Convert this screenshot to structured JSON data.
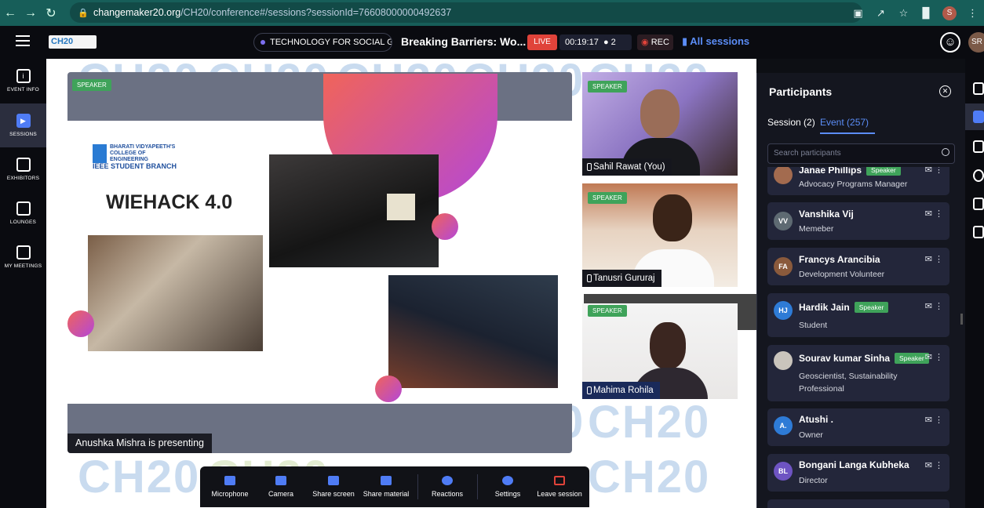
{
  "browser": {
    "url_domain": "changemaker20.org",
    "url_path": "/CH20/conference#/sessions?sessionId=76608000000492637",
    "profile_initial": "S"
  },
  "header": {
    "logo_text": "CH20",
    "track_label": "TECHNOLOGY FOR SOCIAL GO...",
    "session_title": "Breaking Barriers: Wo...",
    "live_label": "LIVE",
    "timer": "00:19:17",
    "attendee_count": "2",
    "rec_label": "REC",
    "all_sessions_label": "All sessions",
    "user_initials": "SR"
  },
  "left_nav": [
    {
      "label": "EVENT INFO",
      "icon": "info-icon",
      "active": false
    },
    {
      "label": "SESSIONS",
      "icon": "play-icon",
      "active": true
    },
    {
      "label": "EXHIBITORS",
      "icon": "store-icon",
      "active": false
    },
    {
      "label": "LOUNGES",
      "icon": "handshake-icon",
      "active": false
    },
    {
      "label": "MY MEETINGS",
      "icon": "calendar-icon",
      "active": false
    }
  ],
  "stage": {
    "watermark_text": "CH20",
    "speaker_badge": "SPEAKER",
    "presenter_label": "Anushka Mishra is presenting",
    "slide": {
      "college_lines": [
        "BHARATI VIDYAPEETH'S",
        "COLLEGE OF ENGINEERING",
        "IEEE STUDENT BRANCH"
      ],
      "title": "WIEHACK 4.0"
    }
  },
  "videos": [
    {
      "name": "Sahil Rawat (You)",
      "badge": "SPEAKER"
    },
    {
      "name": "Tanusri Gururaj",
      "badge": "SPEAKER"
    },
    {
      "name": "Mahima Rohila",
      "badge": "SPEAKER"
    }
  ],
  "controls": [
    {
      "label": "Microphone",
      "icon": "microphone-off-icon"
    },
    {
      "label": "Camera",
      "icon": "camera-icon"
    },
    {
      "label": "Share screen",
      "icon": "share-screen-icon"
    },
    {
      "label": "Share material",
      "icon": "share-material-icon"
    },
    {
      "label": "Reactions",
      "icon": "smiley-icon"
    },
    {
      "label": "Settings",
      "icon": "gear-icon"
    },
    {
      "label": "Leave session",
      "icon": "exit-icon"
    }
  ],
  "participants": {
    "title": "Participants",
    "tab_session": "Session (2)",
    "tab_event": "Event (257)",
    "search_placeholder": "Search participants",
    "speaker_badge": "Speaker",
    "list": [
      {
        "initials": "",
        "name": "Janae Phillips",
        "speaker": true,
        "role": "Advocacy Programs Manager",
        "avatar_color": "#a36b4f"
      },
      {
        "initials": "VV",
        "name": "Vanshika Vij",
        "speaker": false,
        "role": "Memeber",
        "avatar_color": "#5e6a72"
      },
      {
        "initials": "FA",
        "name": "Francys Arancibia",
        "speaker": false,
        "role": "Development Volunteer",
        "avatar_color": "#8a5a3c"
      },
      {
        "initials": "HJ",
        "name": "Hardik Jain",
        "speaker": true,
        "role": "Student",
        "avatar_color": "#2e7bd6"
      },
      {
        "initials": "",
        "name": "Sourav kumar Sinha",
        "speaker": true,
        "role": "Geoscientist, Sustainability Professional",
        "avatar_color": "#c9c4bc"
      },
      {
        "initials": "A.",
        "name": "Atushi .",
        "speaker": false,
        "role": "Owner",
        "avatar_color": "#2e7bd6"
      },
      {
        "initials": "BL",
        "name": "Bongani Langa Kubheka",
        "speaker": false,
        "role": "Director",
        "avatar_color": "#6e54c2"
      }
    ]
  },
  "right_rail": [
    "person-icon",
    "people-icon",
    "chart-icon",
    "question-icon",
    "chat-icon",
    "bot-icon"
  ]
}
